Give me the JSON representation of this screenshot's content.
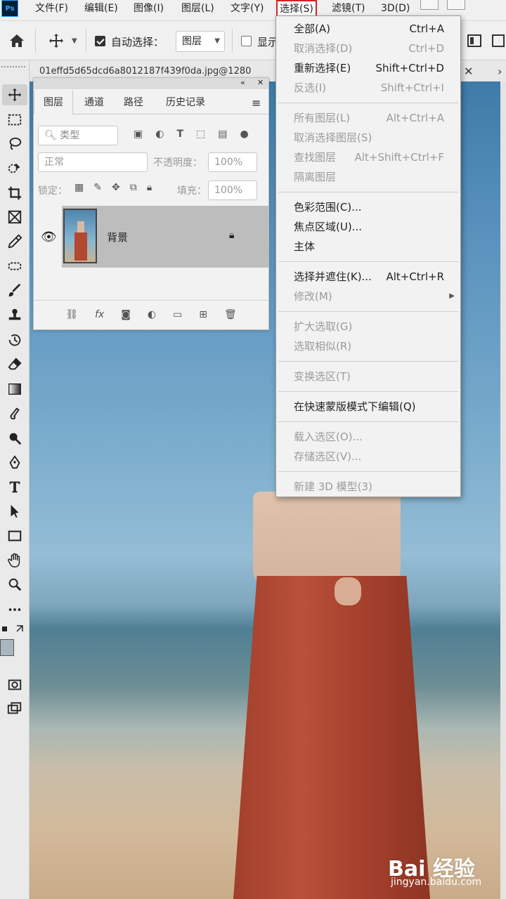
{
  "app": {
    "logo": "Ps"
  },
  "menubar": {
    "items": [
      "文件(F)",
      "编辑(E)",
      "图像(I)",
      "图层(L)",
      "文字(Y)",
      "选择(S)",
      "滤镜(T)",
      "3D(D)"
    ],
    "selected": "选择(S)"
  },
  "options": {
    "auto_select_label": "自动选择：",
    "auto_select_checked": true,
    "auto_select_target": "图层",
    "show_label": "显示"
  },
  "document": {
    "tab_title": "01effd5d65dcd6a8012187f439f0da.jpg@1280"
  },
  "layers_panel": {
    "tabs": [
      "图层",
      "通道",
      "路径",
      "历史记录"
    ],
    "active_tab": "图层",
    "filter_placeholder": "类型",
    "blend_mode": "正常",
    "opacity_label": "不透明度：",
    "opacity_value": "100%",
    "lock_label": "锁定：",
    "fill_label": "填充：",
    "fill_value": "100%",
    "layers": [
      {
        "name": "背景",
        "visible": true,
        "locked": true
      }
    ]
  },
  "select_menu": {
    "groups": [
      [
        {
          "label": "全部(A)",
          "shortcut": "Ctrl+A",
          "enabled": true
        },
        {
          "label": "取消选择(D)",
          "shortcut": "Ctrl+D",
          "enabled": false
        },
        {
          "label": "重新选择(E)",
          "shortcut": "Shift+Ctrl+D",
          "enabled": true
        },
        {
          "label": "反选(I)",
          "shortcut": "Shift+Ctrl+I",
          "enabled": false
        }
      ],
      [
        {
          "label": "所有图层(L)",
          "shortcut": "Alt+Ctrl+A",
          "enabled": false
        },
        {
          "label": "取消选择图层(S)",
          "shortcut": "",
          "enabled": false
        },
        {
          "label": "查找图层",
          "shortcut": "Alt+Shift+Ctrl+F",
          "enabled": false
        },
        {
          "label": "隔离图层",
          "shortcut": "",
          "enabled": false
        }
      ],
      [
        {
          "label": "色彩范围(C)...",
          "shortcut": "",
          "enabled": true
        },
        {
          "label": "焦点区域(U)...",
          "shortcut": "",
          "enabled": true
        },
        {
          "label": "主体",
          "shortcut": "",
          "enabled": true
        }
      ],
      [
        {
          "label": "选择并遮住(K)...",
          "shortcut": "Alt+Ctrl+R",
          "enabled": true
        },
        {
          "label": "修改(M)",
          "shortcut": "",
          "enabled": false,
          "submenu": true
        }
      ],
      [
        {
          "label": "扩大选取(G)",
          "shortcut": "",
          "enabled": false
        },
        {
          "label": "选取相似(R)",
          "shortcut": "",
          "enabled": false
        }
      ],
      [
        {
          "label": "变换选区(T)",
          "shortcut": "",
          "enabled": false
        }
      ],
      [
        {
          "label": "在快速蒙版模式下编辑(Q)",
          "shortcut": "",
          "enabled": true
        }
      ],
      [
        {
          "label": "载入选区(O)...",
          "shortcut": "",
          "enabled": false
        },
        {
          "label": "存储选区(V)...",
          "shortcut": "",
          "enabled": false
        }
      ],
      [
        {
          "label": "新建 3D 模型(3)",
          "shortcut": "",
          "enabled": false
        }
      ]
    ]
  },
  "watermark": {
    "brand": "Bai 经验",
    "url": "jingyan.baidu.com"
  },
  "colors": {
    "menu_highlight_border": "#d2232a",
    "ps_logo_bg": "#001e36"
  }
}
